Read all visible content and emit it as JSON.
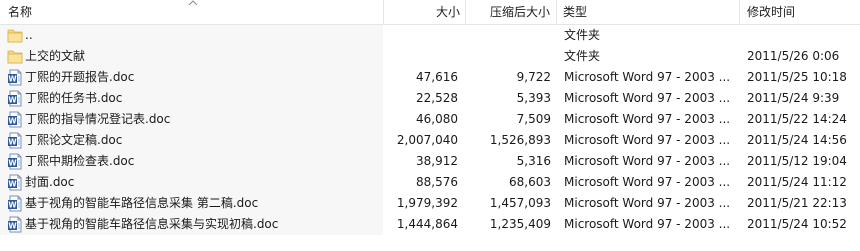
{
  "columns": {
    "name": "名称",
    "size": "大小",
    "compressed": "压缩后大小",
    "type": "类型",
    "modified": "修改时间"
  },
  "rows": [
    {
      "icon": "folder-up-icon",
      "name": "..",
      "size": "",
      "compressed": "",
      "type": "文件夹",
      "modified": ""
    },
    {
      "icon": "folder-icon",
      "name": "上交的文献",
      "size": "",
      "compressed": "",
      "type": "文件夹",
      "modified": "2011/5/26 0:06"
    },
    {
      "icon": "word-doc-icon",
      "name": "丁熙的开题报告.doc",
      "size": "47,616",
      "compressed": "9,722",
      "type": "Microsoft Word 97 - 2003 ...",
      "modified": "2011/5/25 10:18"
    },
    {
      "icon": "word-doc-icon",
      "name": "丁熙的任务书.doc",
      "size": "22,528",
      "compressed": "5,393",
      "type": "Microsoft Word 97 - 2003 ...",
      "modified": "2011/5/24 9:39"
    },
    {
      "icon": "word-doc-icon",
      "name": "丁熙的指导情况登记表.doc",
      "size": "46,080",
      "compressed": "7,509",
      "type": "Microsoft Word 97 - 2003 ...",
      "modified": "2011/5/22 14:24"
    },
    {
      "icon": "word-doc-icon",
      "name": "丁熙论文定稿.doc",
      "size": "2,007,040",
      "compressed": "1,526,893",
      "type": "Microsoft Word 97 - 2003 ...",
      "modified": "2011/5/24 14:56"
    },
    {
      "icon": "word-doc-icon",
      "name": "丁熙中期检查表.doc",
      "size": "38,912",
      "compressed": "5,316",
      "type": "Microsoft Word 97 - 2003 ...",
      "modified": "2011/5/12 19:04"
    },
    {
      "icon": "word-doc-icon",
      "name": "封面.doc",
      "size": "88,576",
      "compressed": "68,603",
      "type": "Microsoft Word 97 - 2003 ...",
      "modified": "2011/5/24 11:12"
    },
    {
      "icon": "word-doc-icon",
      "name": "基于视角的智能车路径信息采集 第二稿.doc",
      "size": "1,979,392",
      "compressed": "1,457,093",
      "type": "Microsoft Word 97 - 2003 ...",
      "modified": "2011/5/21 22:13"
    },
    {
      "icon": "word-doc-icon",
      "name": "基于视角的智能车路径信息采集与实现初稿.doc",
      "size": "1,444,864",
      "compressed": "1,235,409",
      "type": "Microsoft Word 97 - 2003 ...",
      "modified": "2011/5/24 10:52"
    }
  ],
  "colors": {
    "folder": "#f8d775",
    "doc_blue": "#2b5797",
    "name_bg": "#f7f7f7",
    "header_border": "#e5e5e5"
  }
}
